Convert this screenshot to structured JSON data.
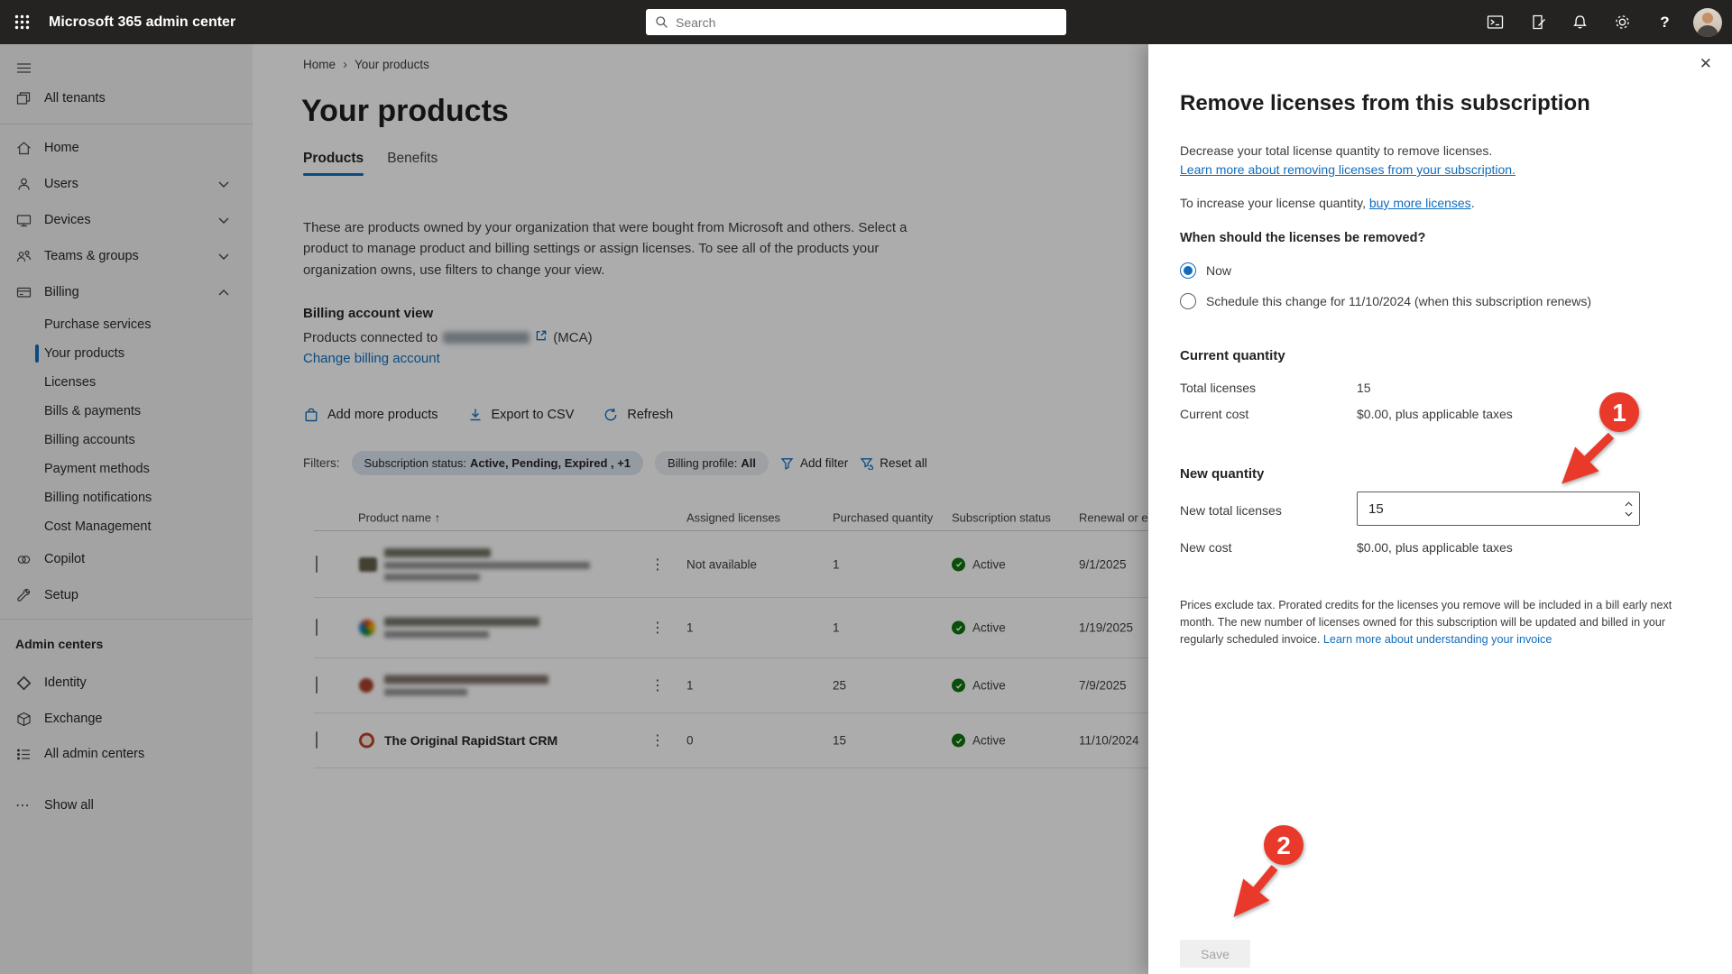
{
  "glyphs": {
    "sort_asc": "↑",
    "breadcrumb_sep": "›",
    "kebab": "⋮",
    "close": "✕",
    "ellipsis": "⋯",
    "question_mark": "?"
  },
  "colors": {
    "accent": "#0f6cbd",
    "annotation_red": "#e8392b",
    "status_green": "#0e700e",
    "topbar_bg": "#242322"
  },
  "topbar": {
    "app_title": "Microsoft 365 admin center",
    "search_placeholder": "Search"
  },
  "sidebar": {
    "items": [
      {
        "label": "All tenants"
      },
      {
        "label": "Home"
      },
      {
        "label": "Users",
        "chevron": "down"
      },
      {
        "label": "Devices",
        "chevron": "down"
      },
      {
        "label": "Teams & groups",
        "chevron": "down"
      },
      {
        "label": "Billing",
        "chevron": "up",
        "expanded": true
      }
    ],
    "billing_children": [
      {
        "label": "Purchase services"
      },
      {
        "label": "Your products",
        "selected": true
      },
      {
        "label": "Licenses"
      },
      {
        "label": "Bills & payments"
      },
      {
        "label": "Billing accounts"
      },
      {
        "label": "Payment methods"
      },
      {
        "label": "Billing notifications"
      },
      {
        "label": "Cost Management"
      }
    ],
    "secondary": [
      {
        "label": "Copilot"
      },
      {
        "label": "Setup"
      }
    ],
    "admin_centers_header": "Admin centers",
    "admin_items": [
      {
        "label": "Identity"
      },
      {
        "label": "Exchange"
      },
      {
        "label": "All admin centers"
      }
    ],
    "show_all": "Show all"
  },
  "main": {
    "breadcrumb": {
      "home": "Home",
      "current": "Your products"
    },
    "title": "Your products",
    "tabs": [
      {
        "label": "Products",
        "active": true
      },
      {
        "label": "Benefits"
      }
    ],
    "description": "These are products owned by your organization that were bought from Microsoft and others. Select a product to manage product and billing settings or assign licenses. To see all of the products your organization owns, use filters to change your view.",
    "billing_account": {
      "heading": "Billing account view",
      "connected_prefix": "Products connected to",
      "connected_suffix": "(MCA)",
      "change_link": "Change billing account"
    },
    "toolbar": {
      "add_products": "Add more products",
      "export_csv": "Export to CSV",
      "refresh": "Refresh"
    },
    "filters": {
      "label": "Filters:",
      "subscription_status_label": "Subscription status:",
      "subscription_status_value": "Active, Pending, Expired , +1",
      "billing_profile_label": "Billing profile:",
      "billing_profile_value": "All",
      "add_filter": "Add filter",
      "reset_all": "Reset all"
    },
    "table": {
      "headers": {
        "product": "Product name",
        "assigned": "Assigned licenses",
        "purchased": "Purchased quantity",
        "status": "Subscription status",
        "renewal": "Renewal or expi"
      },
      "rows": [
        {
          "name_redacted": true,
          "assigned": "Not available",
          "purchased": "1",
          "status": "Active",
          "renewal": "9/1/2025"
        },
        {
          "name_redacted": true,
          "assigned": "1",
          "purchased": "1",
          "status": "Active",
          "renewal": "1/19/2025"
        },
        {
          "name_redacted": true,
          "assigned": "1",
          "purchased": "25",
          "status": "Active",
          "renewal": "7/9/2025"
        },
        {
          "name": "The Original RapidStart CRM",
          "assigned": "0",
          "purchased": "15",
          "status": "Active",
          "renewal": "11/10/2024"
        }
      ]
    }
  },
  "panel": {
    "title": "Remove licenses from this subscription",
    "intro_line": "Decrease your total license quantity to remove licenses.",
    "intro_link": "Learn more about removing licenses from your subscription.",
    "increase_prefix": "To increase your license quantity, ",
    "increase_link": "buy more licenses",
    "increase_suffix": ".",
    "when_heading": "When should the licenses be removed?",
    "radio_now": "Now",
    "radio_schedule": "Schedule this change for 11/10/2024 (when this subscription renews)",
    "current_heading": "Current quantity",
    "total_label": "Total licenses",
    "total_value": "15",
    "current_cost_label": "Current cost",
    "current_cost_value": "$0.00, plus applicable taxes",
    "new_heading": "New quantity",
    "new_total_label": "New total licenses",
    "new_total_value": "15",
    "new_cost_label": "New cost",
    "new_cost_value": "$0.00, plus applicable taxes",
    "fine_print": "Prices exclude tax. Prorated credits for the licenses you remove will be included in a bill early next month. The new number of licenses owned for this subscription will be updated and billed in your regularly scheduled invoice. ",
    "fine_print_link": "Learn more about understanding your invoice",
    "save_label": "Save"
  },
  "annotations": {
    "step1": "1",
    "step2": "2"
  }
}
